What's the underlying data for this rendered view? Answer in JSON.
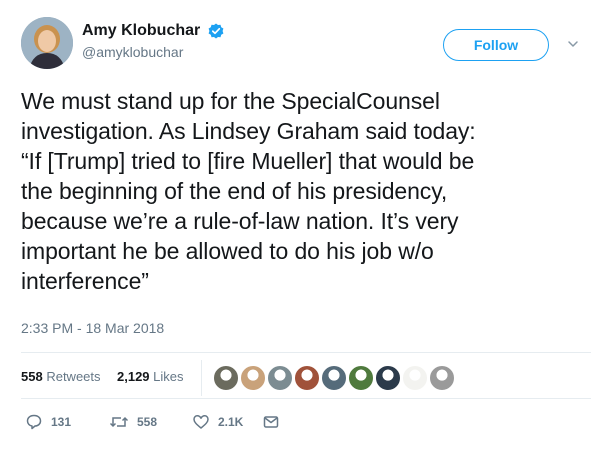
{
  "user": {
    "display_name": "Amy Klobuchar",
    "handle": "@amyklobuchar",
    "verified": true,
    "avatar_icon": "avatar-photo"
  },
  "follow_button": {
    "label": "Follow"
  },
  "menu_icon": "chevron-down-icon",
  "tweet": {
    "text": "We must stand up for the SpecialCounsel\ninvestigation. As Lindsey Graham said today:\n“If [Trump] tried to [fire Mueller] that would be\nthe beginning of the end of his presidency,\nbecause we’re a rule-of-law nation. It’s very\nimportant he be allowed to do his job w/o\ninterference”",
    "timestamp": "2:33 PM - 18 Mar 2018"
  },
  "stats": {
    "retweets_count": "558",
    "retweets_label": "Retweets",
    "likes_count": "2,129",
    "likes_label": "Likes",
    "liker_avatars": [
      {
        "name": "liker-1",
        "color": "#6b6b5e"
      },
      {
        "name": "liker-2",
        "color": "#c9a27a"
      },
      {
        "name": "liker-3",
        "color": "#7c8c92"
      },
      {
        "name": "liker-4",
        "color": "#a0523a"
      },
      {
        "name": "liker-5",
        "color": "#556b7a"
      },
      {
        "name": "liker-6",
        "color": "#4f7a3d"
      },
      {
        "name": "liker-7",
        "color": "#2b3a4a"
      },
      {
        "name": "liker-8",
        "color": "#f3f3f0"
      },
      {
        "name": "liker-9",
        "color": "#9a9a9a"
      }
    ]
  },
  "actions": {
    "replies": "131",
    "retweets": "558",
    "likes": "2.1K"
  },
  "colors": {
    "accent": "#1da1f2",
    "text": "#14171a",
    "muted": "#657786",
    "divider": "#e6ecf0"
  }
}
